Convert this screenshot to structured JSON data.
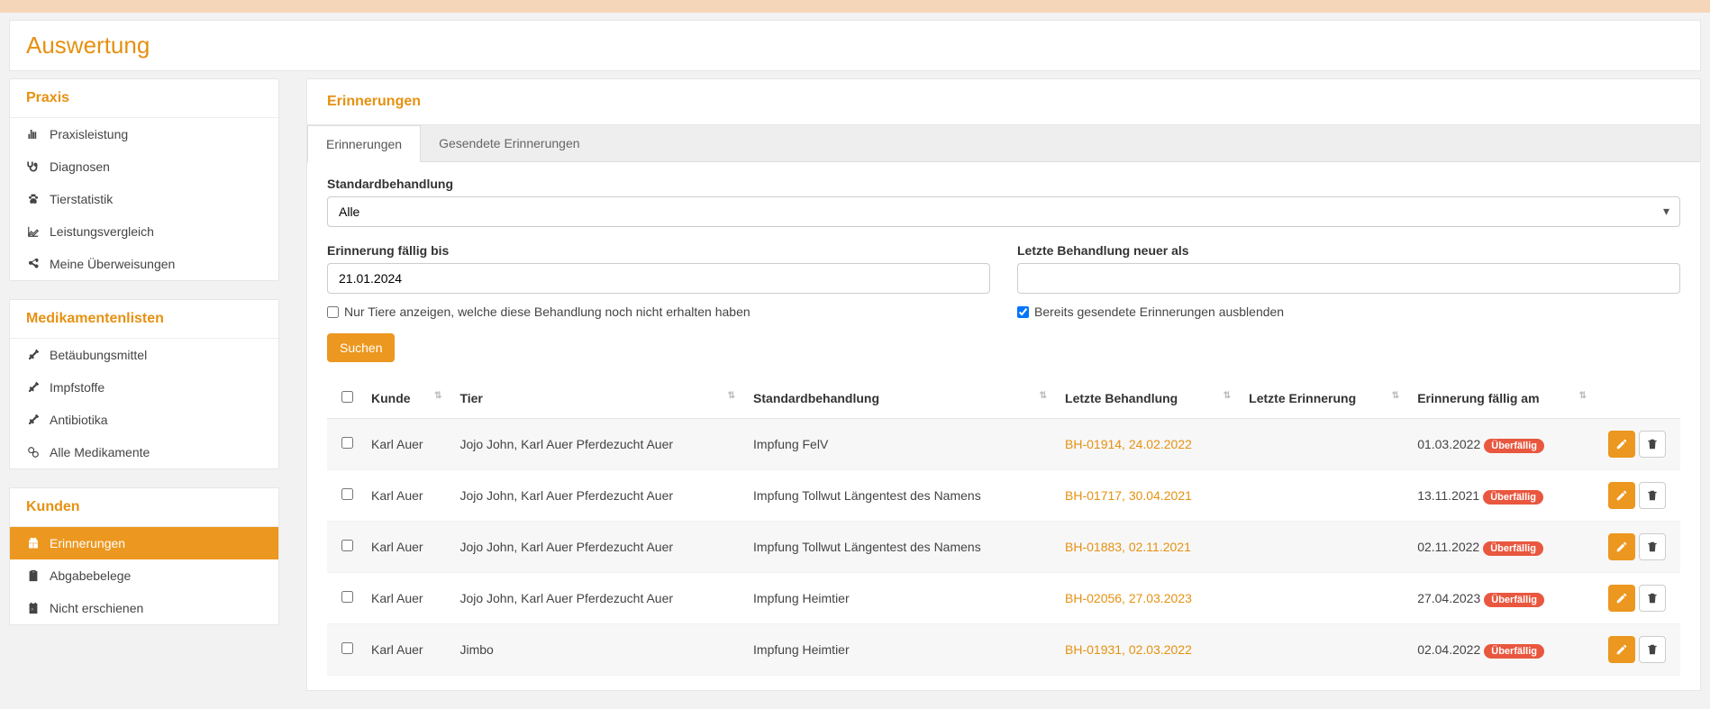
{
  "page_title": "Auswertung",
  "sidebar": {
    "praxis": {
      "heading": "Praxis",
      "items": [
        {
          "label": "Praxisleistung",
          "icon": "bar-chart"
        },
        {
          "label": "Diagnosen",
          "icon": "stethoscope"
        },
        {
          "label": "Tierstatistik",
          "icon": "paw"
        },
        {
          "label": "Leistungsvergleich",
          "icon": "line-chart"
        },
        {
          "label": "Meine Überweisungen",
          "icon": "share"
        }
      ]
    },
    "medikamente": {
      "heading": "Medikamentenlisten",
      "items": [
        {
          "label": "Betäubungsmittel",
          "icon": "syringe"
        },
        {
          "label": "Impfstoffe",
          "icon": "syringe"
        },
        {
          "label": "Antibiotika",
          "icon": "syringe"
        },
        {
          "label": "Alle Medikamente",
          "icon": "pills"
        }
      ]
    },
    "kunden": {
      "heading": "Kunden",
      "items": [
        {
          "label": "Erinnerungen",
          "icon": "gift",
          "active": true
        },
        {
          "label": "Abgabebelege",
          "icon": "clipboard"
        },
        {
          "label": "Nicht erschienen",
          "icon": "calendar-x"
        }
      ]
    }
  },
  "main": {
    "panel_heading": "Erinnerungen",
    "tabs": [
      {
        "label": "Erinnerungen",
        "active": true
      },
      {
        "label": "Gesendete Erinnerungen",
        "active": false
      }
    ],
    "form": {
      "standardbehandlung_label": "Standardbehandlung",
      "standardbehandlung_value": "Alle",
      "faellig_bis_label": "Erinnerung fällig bis",
      "faellig_bis_value": "21.01.2024",
      "letzte_behandlung_label": "Letzte Behandlung neuer als",
      "letzte_behandlung_value": "",
      "checkbox_nur_tiere": "Nur Tiere anzeigen, welche diese Behandlung noch nicht erhalten haben",
      "checkbox_ausblenden": "Bereits gesendete Erinnerungen ausblenden",
      "search_button": "Suchen"
    },
    "table": {
      "columns": [
        "",
        "Kunde",
        "Tier",
        "Standardbehandlung",
        "Letzte Behandlung",
        "Letzte Erinnerung",
        "Erinnerung fällig am",
        ""
      ],
      "overdue_label": "Überfällig",
      "rows": [
        {
          "kunde": "Karl Auer",
          "tier": "Jojo John, Karl Auer Pferdezucht Auer",
          "behandlung": "Impfung FelV",
          "letzte": "BH-01914, 24.02.2022",
          "letzte_erinnerung": "",
          "faellig": "01.03.2022",
          "overdue": true
        },
        {
          "kunde": "Karl Auer",
          "tier": "Jojo John, Karl Auer Pferdezucht Auer",
          "behandlung": "Impfung Tollwut Längentest des Namens",
          "letzte": "BH-01717, 30.04.2021",
          "letzte_erinnerung": "",
          "faellig": "13.11.2021",
          "overdue": true
        },
        {
          "kunde": "Karl Auer",
          "tier": "Jojo John, Karl Auer Pferdezucht Auer",
          "behandlung": "Impfung Tollwut Längentest des Namens",
          "letzte": "BH-01883, 02.11.2021",
          "letzte_erinnerung": "",
          "faellig": "02.11.2022",
          "overdue": true
        },
        {
          "kunde": "Karl Auer",
          "tier": "Jojo John, Karl Auer Pferdezucht Auer",
          "behandlung": "Impfung Heimtier",
          "letzte": "BH-02056, 27.03.2023",
          "letzte_erinnerung": "",
          "faellig": "27.04.2023",
          "overdue": true
        },
        {
          "kunde": "Karl Auer",
          "tier": "Jimbo",
          "behandlung": "Impfung Heimtier",
          "letzte": "BH-01931, 02.03.2022",
          "letzte_erinnerung": "",
          "faellig": "02.04.2022",
          "overdue": true
        }
      ]
    }
  }
}
